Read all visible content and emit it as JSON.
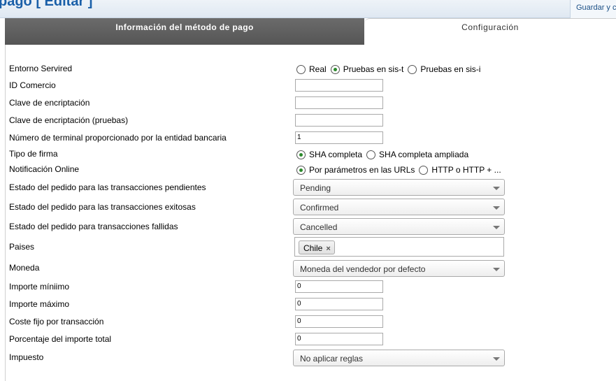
{
  "header": {
    "title": "pago [ Editar ]",
    "save_label": "Guardar y cerrar"
  },
  "tabs": [
    {
      "label": "Información del método de pago",
      "active": true
    },
    {
      "label": "Configuración",
      "active": false
    }
  ],
  "form": {
    "entorno": {
      "label": "Entorno Servired",
      "options": [
        "Real",
        "Pruebas en sis-t",
        "Pruebas en sis-i"
      ],
      "selected": "Pruebas en sis-t"
    },
    "id_comercio": {
      "label": "ID Comercio",
      "value": ""
    },
    "clave": {
      "label": "Clave de encriptación",
      "value": ""
    },
    "clave_pruebas": {
      "label": "Clave de encriptación (pruebas)",
      "value": ""
    },
    "terminal": {
      "label": "Número de terminal proporcionado por la entidad bancaria",
      "value": "1"
    },
    "tipo_firma": {
      "label": "Tipo de firma",
      "options": [
        "SHA completa",
        "SHA completa ampliada"
      ],
      "selected": "SHA completa"
    },
    "notificacion": {
      "label": "Notificación Online",
      "options": [
        "Por parámetros en las URLs",
        "HTTP o HTTP + ..."
      ],
      "selected": "Por parámetros en las URLs"
    },
    "estado_pendientes": {
      "label": "Estado del pedido para las transacciones pendientes",
      "value": "Pending"
    },
    "estado_exitosas": {
      "label": "Estado del pedido para las transacciones exitosas",
      "value": "Confirmed"
    },
    "estado_fallidas": {
      "label": "Estado del pedido para transacciones fallidas",
      "value": "Cancelled"
    },
    "paises": {
      "label": "Paises",
      "chips": [
        "Chile"
      ],
      "remove_glyph": "×"
    },
    "moneda": {
      "label": "Moneda",
      "value": "Moneda del vendedor por defecto"
    },
    "importe_min": {
      "label": "Importe míniimo",
      "value": "0"
    },
    "importe_max": {
      "label": "Importe máximo",
      "value": "0"
    },
    "coste_fijo": {
      "label": "Coste fijo por transacción",
      "value": "0"
    },
    "porcentaje": {
      "label": "Porcentaje del importe total",
      "value": "0"
    },
    "impuesto": {
      "label": "Impuesto",
      "value": "No aplicar reglas"
    }
  },
  "colors": {
    "accent": "#1a5fa8",
    "radio_checked": "#2b8a2b",
    "tab_active": "#5f5f5f"
  }
}
